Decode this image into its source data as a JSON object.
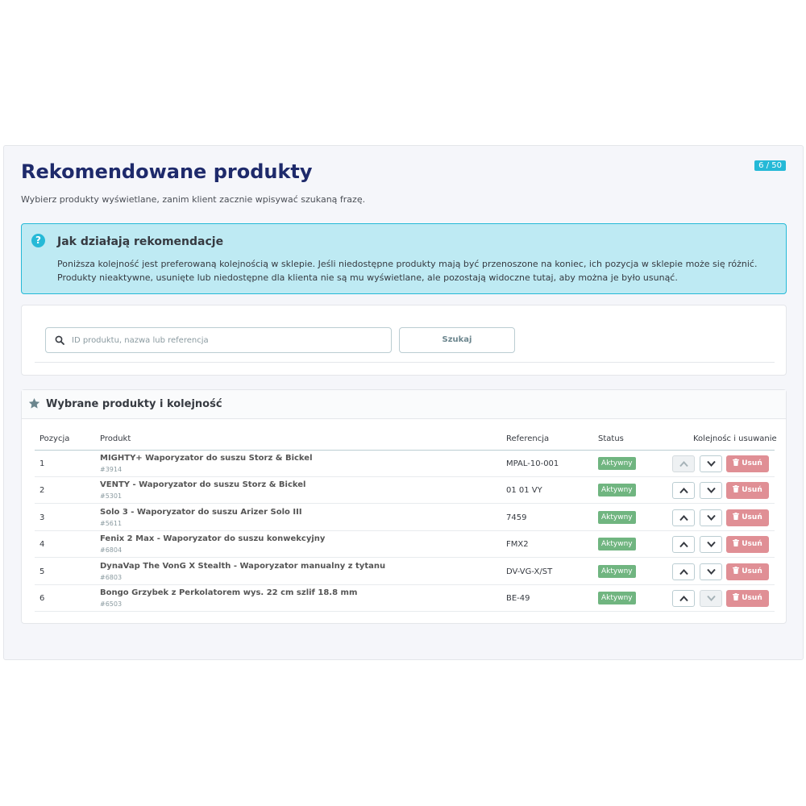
{
  "header": {
    "title": "Rekomendowane produkty",
    "counter": "6 / 50",
    "subtitle": "Wybierz produkty wyświetlane, zanim klient zacznie wpisywać szukaną frazę."
  },
  "info": {
    "icon": "question-circle-icon",
    "title": "Jak działają rekomendacje",
    "text": "Poniższa kolejność jest preferowaną kolejnością w sklepie. Jeśli niedostępne produkty mają być przenoszone na koniec, ich pozycja w sklepie może się różnić. Produkty nieaktywne, usunięte lub niedostępne dla klienta nie są mu wyświetlane, ale pozostają widoczne tutaj, aby można je było usunąć."
  },
  "search": {
    "placeholder": "ID produktu, nazwa lub referencja",
    "value": "",
    "button_label": "Szukaj"
  },
  "products": {
    "title": "Wybrane produkty i kolejność",
    "columns": {
      "position": "Pozycja",
      "product": "Produkt",
      "reference": "Referencja",
      "status": "Status",
      "actions": "Kolejnośc i usuwanie"
    },
    "delete_label": "Usuń",
    "rows": [
      {
        "position": "1",
        "name": "MIGHTY+ Waporyzator do suszu Storz & Bickel",
        "id": "#3914",
        "reference": "MPAL-10-001",
        "status": "Aktywny"
      },
      {
        "position": "2",
        "name": "VENTY - Waporyzator do suszu Storz & Bickel",
        "id": "#5301",
        "reference": "01 01 VY",
        "status": "Aktywny"
      },
      {
        "position": "3",
        "name": "Solo 3 - Waporyzator do suszu Arizer Solo III",
        "id": "#5611",
        "reference": "7459",
        "status": "Aktywny"
      },
      {
        "position": "4",
        "name": "Fenix 2 Max - Waporyzator do suszu konwekcyjny",
        "id": "#6804",
        "reference": "FMX2",
        "status": "Aktywny"
      },
      {
        "position": "5",
        "name": "DynaVap The VonG X Stealth - Waporyzator manualny z tytanu",
        "id": "#6803",
        "reference": "DV-VG-X/ST",
        "status": "Aktywny"
      },
      {
        "position": "6",
        "name": "Bongo Grzybek z Perkolatorem wys. 22 cm szlif 18.8 mm",
        "id": "#6503",
        "reference": "BE-49",
        "status": "Aktywny"
      }
    ]
  },
  "colors": {
    "title": "#1e2a6b",
    "accent": "#25b9d7",
    "info_bg": "#beeaf3",
    "status_active": "#70b580",
    "delete": "#e08f95"
  }
}
